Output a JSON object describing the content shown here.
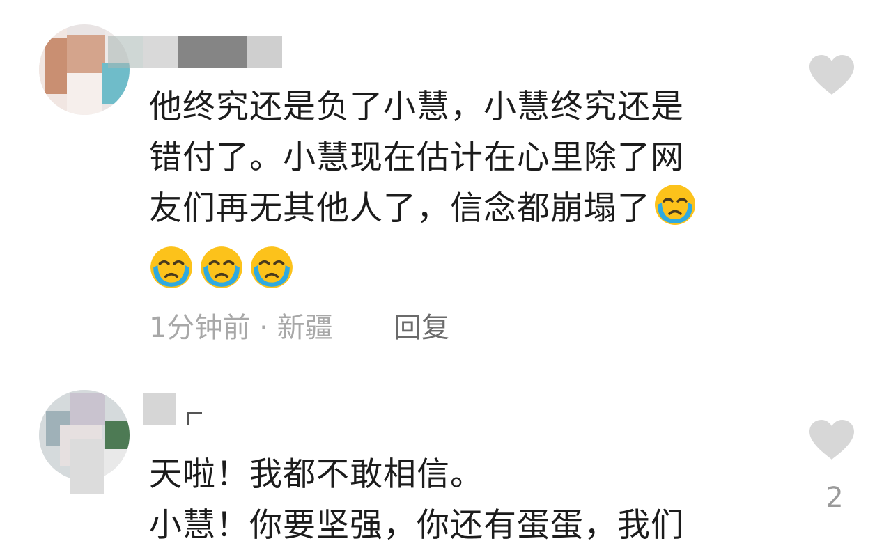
{
  "comments": [
    {
      "text_lines": [
        "他终究还是负了小慧，小慧终究还是",
        "错付了。小慧现在估计在心里除了网",
        "友们再无其他人了，信念都崩塌了"
      ],
      "trailing_emoji": "loudly-crying-face",
      "emoji_row_count": 3,
      "time": "1分钟前",
      "separator": "·",
      "location": "新疆",
      "reply_label": "回复",
      "like_icon": "heart-icon",
      "like_count": ""
    },
    {
      "text_lines": [
        "天啦！我都不敢相信。",
        "小慧！你要坚强，你还有蛋蛋，我们"
      ],
      "like_icon": "heart-icon",
      "like_count": "2"
    }
  ],
  "colors": {
    "text": "#1c1c1c",
    "meta": "#a8a8a8",
    "reply": "#6b6b6b",
    "heart": "#d7d7d7",
    "emoji_face": "#fcc21b",
    "emoji_tears": "#2fa9e0"
  }
}
